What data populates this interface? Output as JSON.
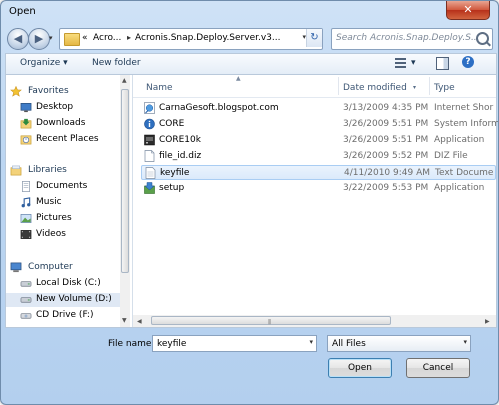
{
  "window": {
    "title": "Open",
    "close_glyph": "✕"
  },
  "nav": {
    "back_glyph": "◀",
    "forward_glyph": "▶",
    "dropdown_glyph": "▾"
  },
  "address": {
    "crumbs": [
      "«",
      "Acro...",
      "Acronis.Snap.Deploy.Server.v3..."
    ],
    "separator_glyph": "▸",
    "dropdown_glyph": "▾",
    "refresh_glyph": "↻"
  },
  "search": {
    "placeholder": "Search Acronis.Snap.Deploy.S..."
  },
  "toolbar": {
    "organize_label": "Organize ▾",
    "new_folder_label": "New folder",
    "view_dropdown_glyph": "▾",
    "help_glyph": "?"
  },
  "sidebar": {
    "favorites": {
      "label": "Favorites",
      "items": [
        "Desktop",
        "Downloads",
        "Recent Places"
      ]
    },
    "libraries": {
      "label": "Libraries",
      "items": [
        "Documents",
        "Music",
        "Pictures",
        "Videos"
      ]
    },
    "computer": {
      "label": "Computer",
      "items": [
        "Local Disk (C:)",
        "New Volume (D:)",
        "CD Drive (F:)"
      ]
    }
  },
  "columns": {
    "name": "Name",
    "date": "Date modified",
    "type": "Type",
    "sort_glyph": "▲",
    "col_drop_glyph": "▾"
  },
  "files": [
    {
      "name": "CarnaGesoft.blogspot.com",
      "date": "3/13/2009 4:35 PM",
      "type": "Internet Shor",
      "icon": "internet-shortcut-icon"
    },
    {
      "name": "CORE",
      "date": "3/26/2009 5:51 PM",
      "type": "System Inform",
      "icon": "system-info-icon"
    },
    {
      "name": "CORE10k",
      "date": "3/26/2009 5:51 PM",
      "type": "Application",
      "icon": "application-icon"
    },
    {
      "name": "file_id.diz",
      "date": "3/26/2009 5:52 PM",
      "type": "DIZ File",
      "icon": "file-icon"
    },
    {
      "name": "keyfile",
      "date": "4/11/2010 9:49 AM",
      "type": "Text Docume",
      "icon": "text-file-icon"
    },
    {
      "name": "setup",
      "date": "3/22/2009 5:53 PM",
      "type": "Application",
      "icon": "setup-icon"
    }
  ],
  "footer": {
    "filename_label": "File name:",
    "filename_value": "keyfile",
    "filetype_value": "All Files",
    "dropdown_glyph": "▾",
    "open_label": "Open",
    "cancel_label": "Cancel"
  },
  "scroll": {
    "up_glyph": "▲",
    "down_glyph": "▼",
    "left_glyph": "◀",
    "right_glyph": "▶",
    "grip_glyph": "|||"
  }
}
